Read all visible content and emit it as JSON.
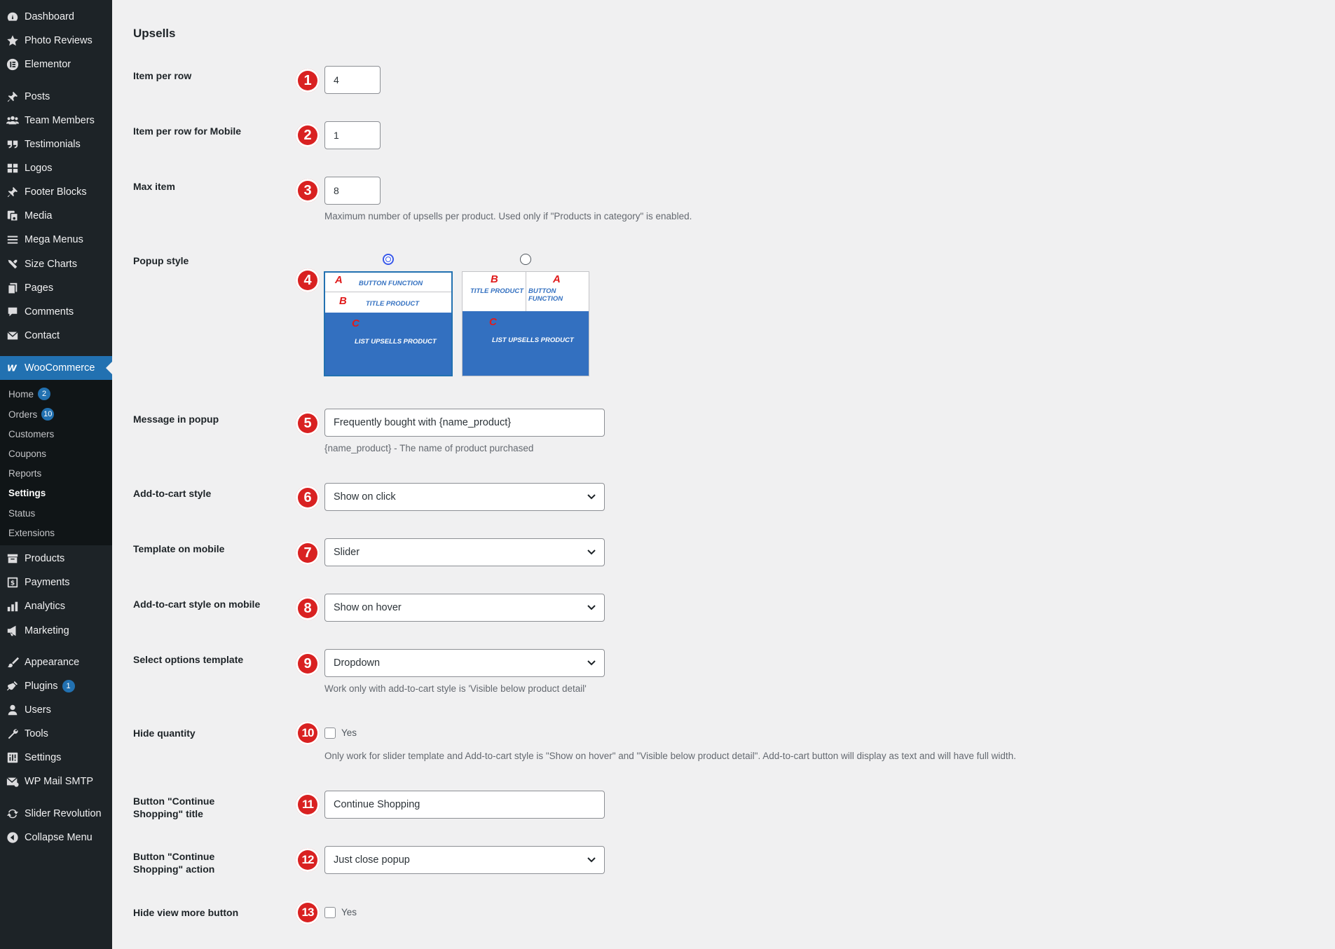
{
  "sidebar": {
    "items": [
      {
        "label": "Dashboard",
        "icon": "dashboard-icon"
      },
      {
        "label": "Photo Reviews",
        "icon": "star-icon"
      },
      {
        "label": "Elementor",
        "icon": "elementor-icon"
      },
      {
        "label": "Posts",
        "icon": "pin-icon"
      },
      {
        "label": "Team Members",
        "icon": "users-group-icon"
      },
      {
        "label": "Testimonials",
        "icon": "quote-icon"
      },
      {
        "label": "Logos",
        "icon": "grid-icon"
      },
      {
        "label": "Footer Blocks",
        "icon": "pin-icon"
      },
      {
        "label": "Media",
        "icon": "media-icon"
      },
      {
        "label": "Mega Menus",
        "icon": "menu-lines-icon"
      },
      {
        "label": "Size Charts",
        "icon": "tools-icon"
      },
      {
        "label": "Pages",
        "icon": "pages-icon"
      },
      {
        "label": "Comments",
        "icon": "comment-icon"
      },
      {
        "label": "Contact",
        "icon": "mail-icon"
      },
      {
        "label": "WooCommerce",
        "icon": "woocommerce-icon"
      },
      {
        "label": "Products",
        "icon": "archive-icon"
      },
      {
        "label": "Payments",
        "icon": "payment-icon"
      },
      {
        "label": "Analytics",
        "icon": "bar-chart-icon"
      },
      {
        "label": "Marketing",
        "icon": "megaphone-icon"
      },
      {
        "label": "Appearance",
        "icon": "brush-icon"
      },
      {
        "label": "Plugins",
        "icon": "plugin-icon",
        "badge": "1"
      },
      {
        "label": "Users",
        "icon": "user-icon"
      },
      {
        "label": "Tools",
        "icon": "wrench-icon"
      },
      {
        "label": "Settings",
        "icon": "settings-icon"
      },
      {
        "label": "WP Mail SMTP",
        "icon": "mail-smtp-icon"
      },
      {
        "label": "Slider Revolution",
        "icon": "refresh-icon"
      },
      {
        "label": "Collapse Menu",
        "icon": "collapse-icon"
      }
    ],
    "submenu": [
      {
        "label": "Home",
        "badge": "2"
      },
      {
        "label": "Orders",
        "badge": "10"
      },
      {
        "label": "Customers"
      },
      {
        "label": "Coupons"
      },
      {
        "label": "Reports"
      },
      {
        "label": "Settings"
      },
      {
        "label": "Status"
      },
      {
        "label": "Extensions"
      }
    ]
  },
  "section_title": "Upsells",
  "fields": {
    "item_per_row": {
      "label": "Item per row",
      "value": "4",
      "marker": "1"
    },
    "item_per_row_mobile": {
      "label": "Item per row for Mobile",
      "value": "1",
      "marker": "2"
    },
    "max_item": {
      "label": "Max item",
      "value": "8",
      "marker": "3",
      "desc": "Maximum number of upsells per product. Used only if \"Products in category\" is enabled."
    },
    "popup_style": {
      "label": "Popup style",
      "marker": "4",
      "options": [
        {
          "selected": true,
          "a": "A",
          "a_text": "BUTTON FUNCTION",
          "b": "B",
          "b_text": "TITLE PRODUCT",
          "c": "C",
          "c_text": "LIST UPSELLS PRODUCT"
        },
        {
          "selected": false,
          "a": "A",
          "a_text": "BUTTON FUNCTION",
          "b": "B",
          "b_text": "TITLE PRODUCT",
          "c": "C",
          "c_text": "LIST UPSELLS PRODUCT"
        }
      ]
    },
    "message_in_popup": {
      "label": "Message in popup",
      "value": "Frequently bought with {name_product}",
      "marker": "5",
      "desc": "{name_product} - The name of product purchased"
    },
    "add_to_cart_style": {
      "label": "Add-to-cart style",
      "value": "Show on click",
      "marker": "6"
    },
    "template_on_mobile": {
      "label": "Template on mobile",
      "value": "Slider",
      "marker": "7"
    },
    "add_to_cart_style_mobile": {
      "label": "Add-to-cart style on mobile",
      "value": "Show on hover",
      "marker": "8"
    },
    "select_options_template": {
      "label": "Select options template",
      "value": "Dropdown",
      "marker": "9",
      "desc": "Work only with add-to-cart style is 'Visible below product detail'"
    },
    "hide_quantity": {
      "label": "Hide quantity",
      "check_label": "Yes",
      "marker": "10",
      "desc": "Only work for slider template and Add-to-cart style is \"Show on hover\" and \"Visible below product detail\". Add-to-cart button will display as text and will have full width."
    },
    "continue_shopping_title": {
      "label": "Button \"Continue Shopping\" title",
      "value": "Continue Shopping",
      "marker": "11"
    },
    "continue_shopping_action": {
      "label": "Button \"Continue Shopping\" action",
      "value": "Just close popup",
      "marker": "12"
    },
    "hide_view_more": {
      "label": "Hide view more button",
      "check_label": "Yes",
      "marker": "13"
    }
  },
  "colors": {
    "sidebar_bg": "#1d2327",
    "active": "#2271b1",
    "marker": "#d92121",
    "card_blue": "#3370c0"
  }
}
